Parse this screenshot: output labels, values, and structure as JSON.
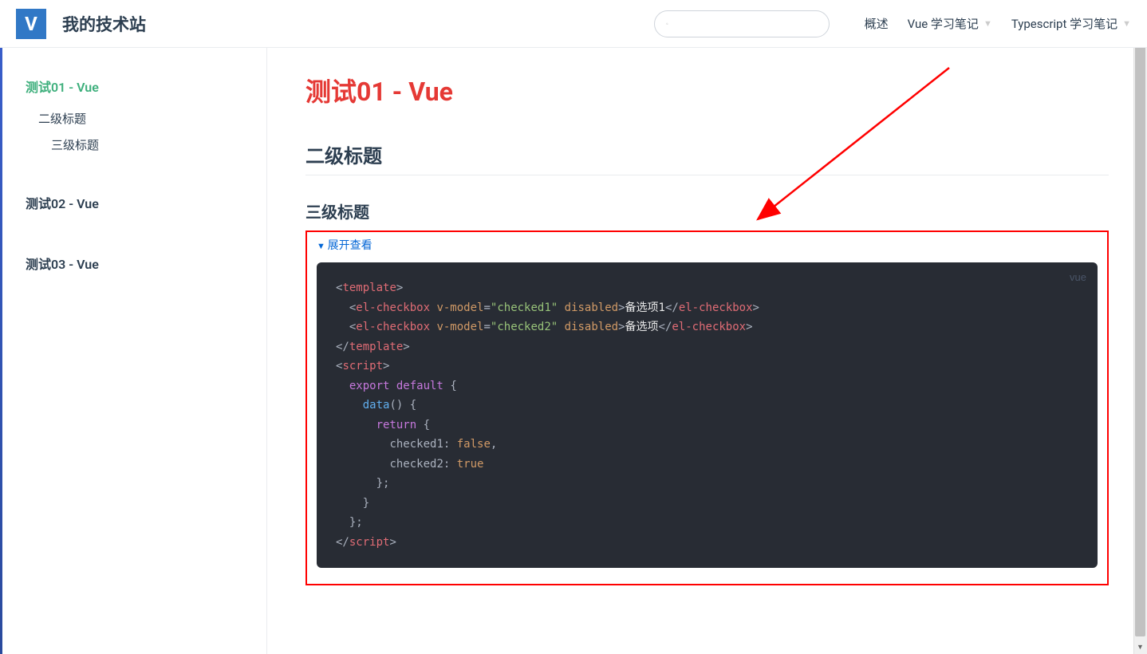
{
  "header": {
    "logo_letter": "V",
    "site_title": "我的技术站",
    "search_placeholder": "",
    "nav": [
      {
        "label": "概述",
        "has_dropdown": false
      },
      {
        "label": "Vue 学习笔记",
        "has_dropdown": true
      },
      {
        "label": "Typescript 学习笔记",
        "has_dropdown": true
      }
    ]
  },
  "sidebar": {
    "items": [
      {
        "label": "测试01 - Vue",
        "active": true,
        "children": [
          {
            "label": "二级标题",
            "children": [
              {
                "label": "三级标题"
              }
            ]
          }
        ]
      },
      {
        "label": "测试02 - Vue",
        "active": false,
        "children": []
      },
      {
        "label": "测试03 - Vue",
        "active": false,
        "children": []
      }
    ]
  },
  "content": {
    "page_title": "测试01 - Vue",
    "h2": "二级标题",
    "h3": "三级标题",
    "expand_label": "展开查看",
    "code_lang": "vue",
    "code": {
      "line1_open": "template",
      "line2_tag": "el-checkbox",
      "line2_attr1": "v-model",
      "line2_val1": "\"checked1\"",
      "line2_attr2": "disabled",
      "line2_text": "备选项1",
      "line3_tag": "el-checkbox",
      "line3_attr1": "v-model",
      "line3_val1": "\"checked2\"",
      "line3_attr2": "disabled",
      "line3_text": "备选项",
      "line4_close": "template",
      "line5_open": "script",
      "line6": "export default",
      "line7_fn": "data",
      "line8_kw": "return",
      "line9_key": "checked1",
      "line9_val": "false",
      "line10_key": "checked2",
      "line10_val": "true",
      "line14_close": "script"
    }
  }
}
